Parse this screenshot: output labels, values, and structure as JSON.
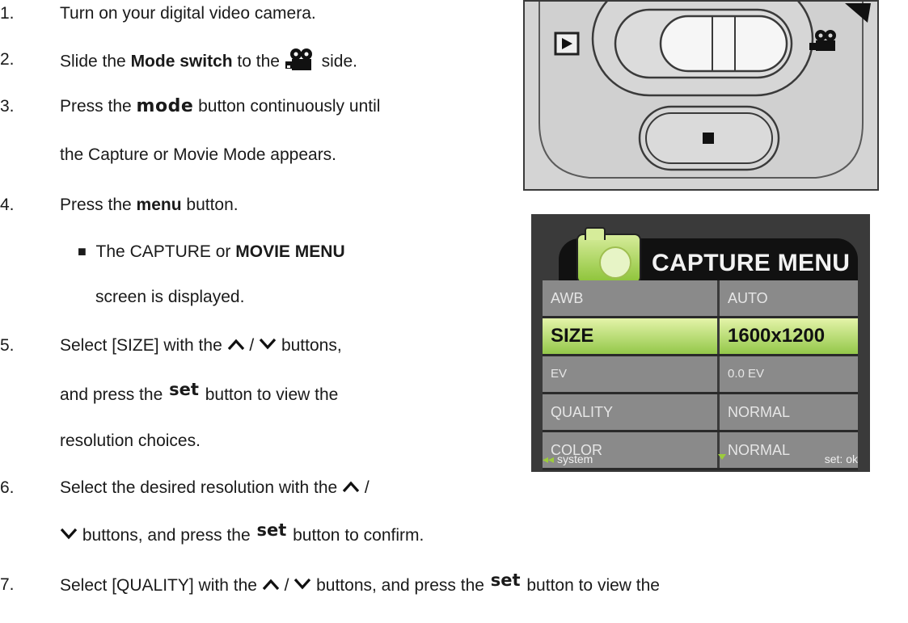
{
  "steps": [
    {
      "num": "1.",
      "text": "Turn on your digital video camera."
    },
    {
      "num": "2.",
      "pre": "Slide the ",
      "bold": "Mode switch",
      "mid": " to the ",
      "post": " side."
    },
    {
      "num": "3.",
      "pre": "Press the ",
      "word": "mode",
      "post": " button continuously until",
      "cont": "the Capture or Movie Mode appears."
    },
    {
      "num": "4.",
      "pre": "Press the ",
      "bold": "menu",
      "post": " button."
    },
    {
      "bullet": "■",
      "pre": "The CAPTURE or ",
      "bold": "MOVIE MENU",
      "cont": "screen is displayed."
    },
    {
      "num": "5.",
      "pre": "Select [SIZE] with the ",
      "mid": " / ",
      "post": " buttons,",
      "l2pre": "and press the ",
      "word": "set",
      "l2post": " button to view the",
      "cont": "resolution choices."
    },
    {
      "num": "6.",
      "pre": "Select the desired resolution with the ",
      "post": " /",
      "l2post": " buttons, and press the ",
      "word": "set",
      "l2end": " button to confirm."
    },
    {
      "num": "7.",
      "pre": "Select [QUALITY] with the ",
      "mid": " / ",
      "post": " buttons, and press the ",
      "word": "set",
      "end": " button to view the"
    }
  ],
  "menu": {
    "title": "CAPTURE MENU",
    "rows": [
      {
        "label": "AWB",
        "value": "AUTO"
      },
      {
        "label": "SIZE",
        "value": "1600x1200"
      },
      {
        "label": "EV",
        "value": "0.0 EV"
      },
      {
        "label": "QUALITY",
        "value": "NORMAL"
      },
      {
        "label": "COLOR",
        "value": "NORMAL"
      }
    ],
    "footer_left": "system",
    "footer_right": "set: ok",
    "accent": "#94c84a"
  },
  "icons": {
    "up": "chevron-up-icon",
    "down": "chevron-down-icon",
    "movie": "movie-camera-icon",
    "playback": "playback-icon",
    "stop": "stop-icon"
  }
}
